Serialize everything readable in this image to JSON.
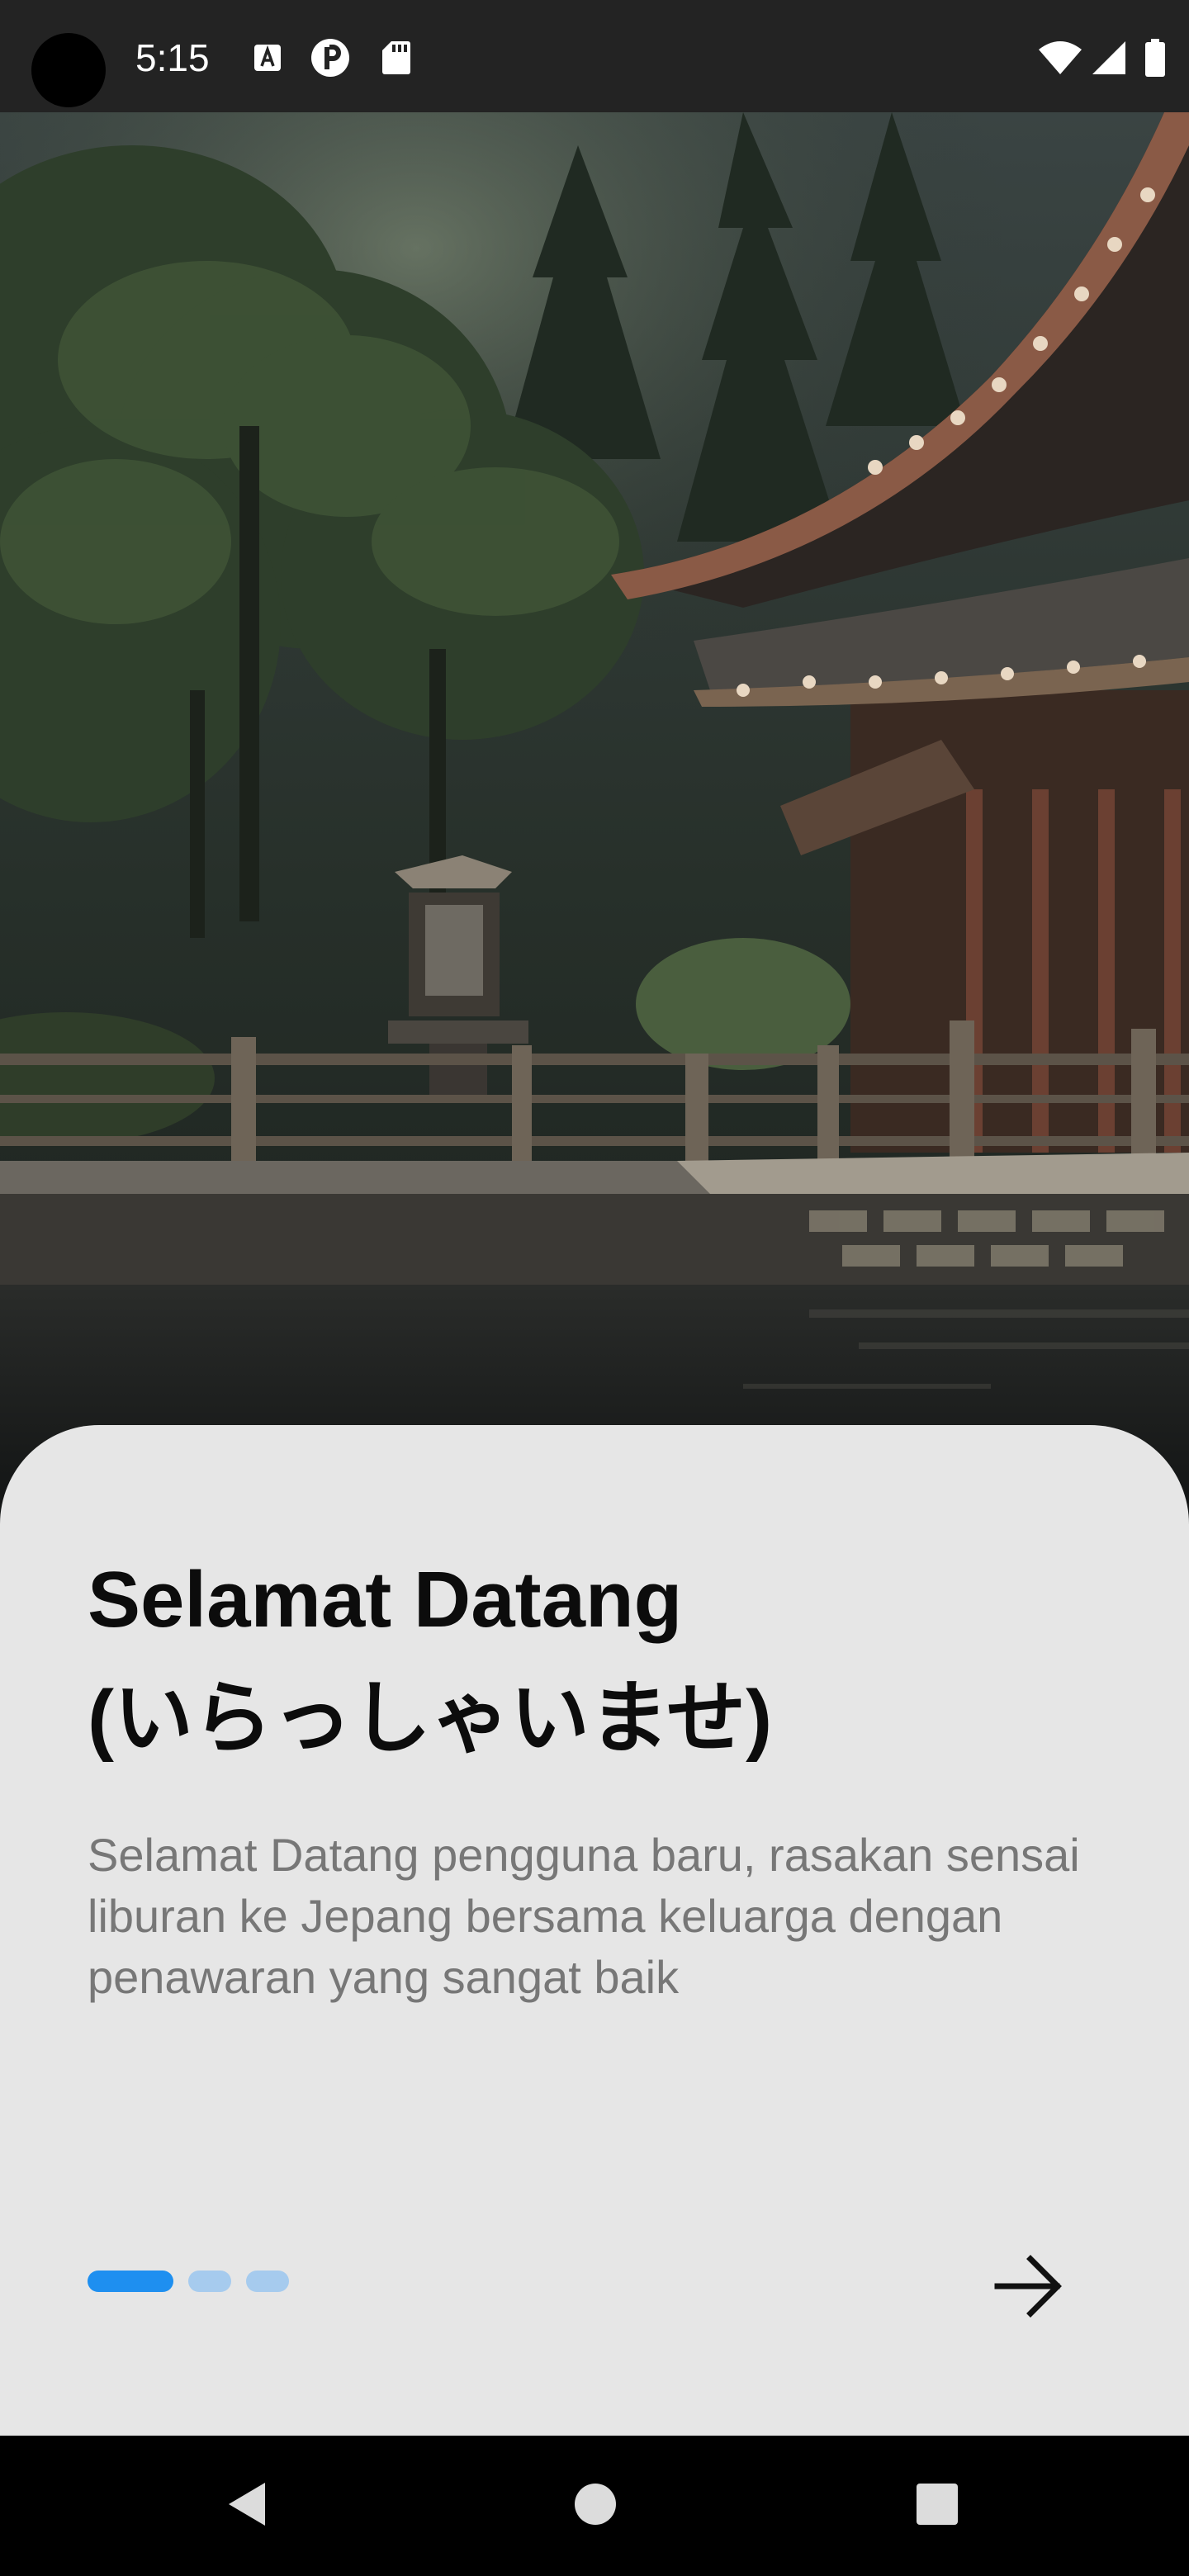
{
  "status_bar": {
    "time": "5:15",
    "icons": [
      "a-box-icon",
      "p-circle-icon",
      "sd-card-icon",
      "wifi-icon",
      "signal-icon",
      "battery-icon"
    ]
  },
  "hero": {
    "image": "japanese-temple-by-lake-illustration"
  },
  "onboarding": {
    "title_line1": "Selamat Datang",
    "title_line2": "(いらっしゃいませ)",
    "description": "Selamat Datang pengguna baru, rasakan sensai liburan ke Jepang bersama keluarga dengan penawaran yang sangat baik",
    "page_indicator": {
      "total": 3,
      "active_index": 0
    },
    "next_icon": "arrow-right-icon"
  },
  "nav_bar": {
    "buttons": [
      "back-icon",
      "home-icon",
      "recents-icon"
    ]
  },
  "colors": {
    "sheet_background": "#e6e6e6",
    "accent": "#1e8ff0",
    "accent_inactive": "#a6cbee",
    "title": "#0c0c0c",
    "description": "#777777",
    "status_bar": "#232323",
    "nav_bar": "#000000"
  }
}
